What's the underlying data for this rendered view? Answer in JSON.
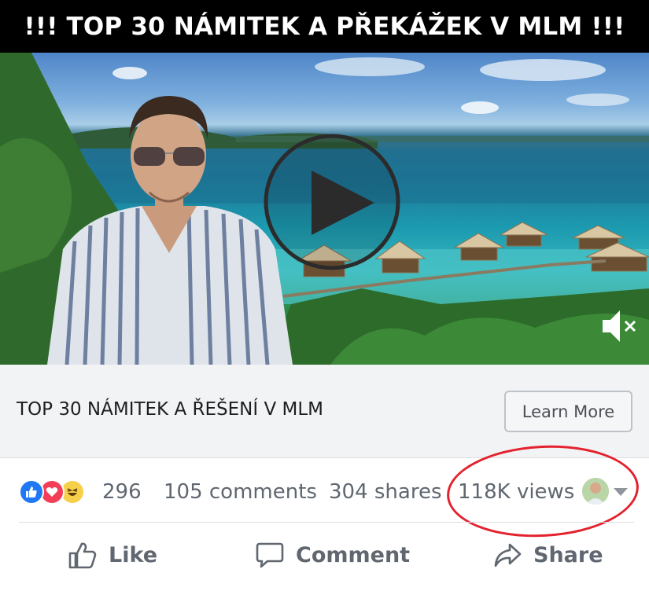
{
  "banner": {
    "text": "!!! TOP 30 NÁMITEK A PŘEKÁŽEK V MLM !!!"
  },
  "video": {
    "play_icon": "play-icon",
    "mute_icon": "muted-speaker-icon"
  },
  "cta": {
    "title": "TOP 30 NÁMITEK A ŘEŠENÍ V MLM",
    "button_label": "Learn More"
  },
  "stats": {
    "reaction_icons": [
      "like-icon",
      "love-icon",
      "haha-icon"
    ],
    "reactions_count": "296",
    "comments": "105 comments",
    "shares": "304 shares",
    "views": "118K views"
  },
  "actions": {
    "like": "Like",
    "comment": "Comment",
    "share": "Share"
  },
  "colors": {
    "like_blue": "#2078f4",
    "love_red": "#f33e58",
    "haha_yellow": "#f7d04b",
    "highlight_red": "#e3222e",
    "text_gray": "#606770"
  }
}
